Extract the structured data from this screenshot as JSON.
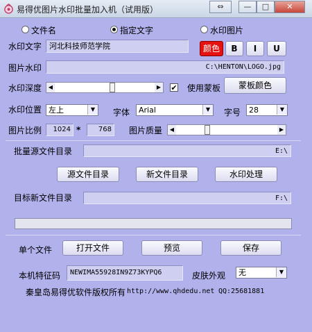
{
  "window": {
    "title": "易得优图片水印批量加入机（试用版）",
    "controls": {
      "restore": "⇔",
      "minimize": "—",
      "maximize": "□",
      "close": "✕"
    }
  },
  "mode": {
    "options": [
      {
        "label": "文件名",
        "selected": false
      },
      {
        "label": "指定文字",
        "selected": true
      },
      {
        "label": "水印图片",
        "selected": false
      }
    ]
  },
  "watermark_text": {
    "label": "水印文字",
    "value": "河北科技师范学院"
  },
  "format_buttons": {
    "color": "颜色",
    "bold": "B",
    "italic": "I",
    "underline": "U",
    "color_hex": "#e61212"
  },
  "image_watermark": {
    "label": "图片水印",
    "value": "C:\\HENTON\\LOGO.jpg"
  },
  "depth": {
    "label": "水印深度",
    "level": 0.58
  },
  "mask": {
    "label": "使用蒙板",
    "checked": true,
    "check_glyph": "✔",
    "color_button": "蒙板颜色"
  },
  "position": {
    "label": "水印位置",
    "value": "左上"
  },
  "font": {
    "label": "字体",
    "value": "Arial"
  },
  "font_size": {
    "label": "字号",
    "value": "28"
  },
  "ratio": {
    "label": "图片比例",
    "width": "1024",
    "separator": "*",
    "height": "768"
  },
  "quality": {
    "label": "图片质量",
    "level": 0.3
  },
  "source_dir": {
    "label": "批量源文件目录",
    "value": "E:\\"
  },
  "actions": {
    "source": "源文件目录",
    "new": "新文件目录",
    "process": "水印处理"
  },
  "target_dir": {
    "label": "目标新文件目录",
    "value": "F:\\"
  },
  "single_file": {
    "label": "单个文件",
    "open": "打开文件",
    "preview": "预览",
    "save": "保存"
  },
  "machine_code": {
    "label": "本机特征码",
    "value": "NEWIMA55928IN9Z73KYPQ6"
  },
  "skin": {
    "label": "皮肤外观",
    "value": "无"
  },
  "footer": {
    "copyright": "秦皇岛易得优软件版权所有",
    "website": "http://www.qhdedu.net",
    "qq": "QQ:25681881"
  }
}
